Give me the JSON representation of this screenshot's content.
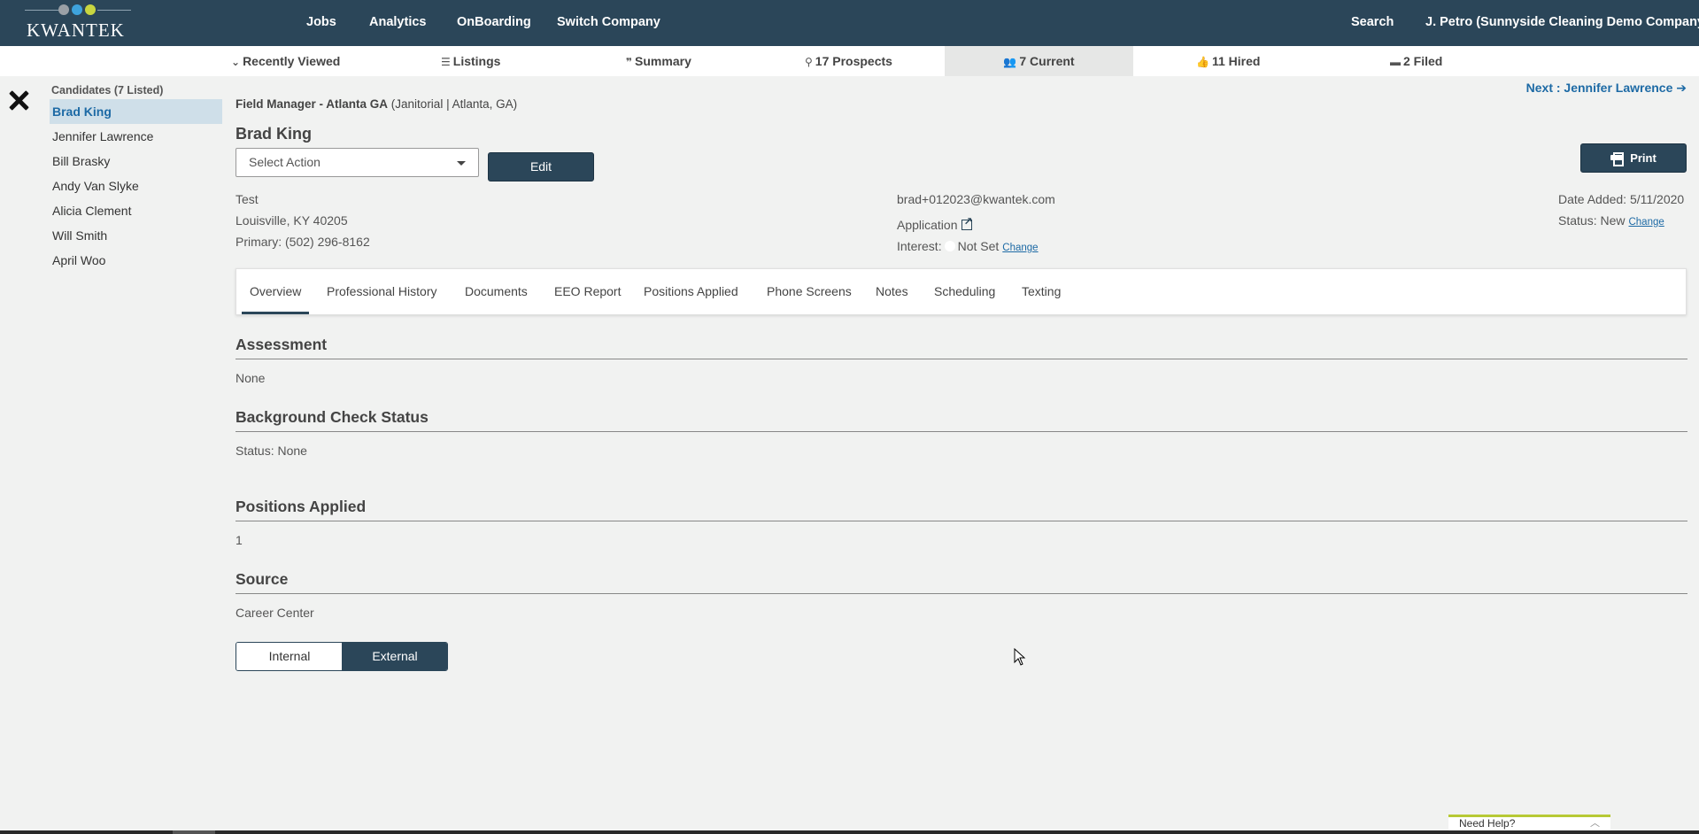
{
  "topnav": {
    "logo_text": "KWANTEK",
    "logo_dot_colors": [
      "#9aa0a6",
      "#3ea3dd",
      "#c8d640"
    ],
    "links": [
      "Jobs",
      "Analytics",
      "OnBoarding",
      "Switch Company"
    ],
    "search": "Search",
    "user": "J. Petro (Sunnyside Cleaning Demo Company)"
  },
  "subnav": {
    "recently_viewed": "Recently Viewed",
    "listings": "Listings",
    "summary": "Summary",
    "prospects": "17 Prospects",
    "current": "7 Current",
    "hired": "11 Hired",
    "filed": "2 Filed"
  },
  "candidates": {
    "header": "Candidates (7 Listed)",
    "items": [
      "Brad King",
      "Jennifer Lawrence",
      "Bill Brasky",
      "Andy Van Slyke",
      "Alicia Clement",
      "Will Smith",
      "April Woo"
    ],
    "selected_index": 0
  },
  "job": {
    "title": "Field Manager - Atlanta GA",
    "detail": "(Janitorial | Atlanta, GA)"
  },
  "next_link": "Next : Jennifer Lawrence",
  "candidate": {
    "name": "Brad King",
    "select_action": "Select Action",
    "edit_label": "Edit",
    "print_label": "Print",
    "address_line1": "Test",
    "address_line2": "Louisville, KY 40205",
    "phone": "Primary: (502) 296-8162",
    "email": "brad+012023@kwantek.com",
    "application": "Application",
    "interest_label": "Interest:",
    "interest_value": "Not Set",
    "interest_change": "Change",
    "date_added": "Date Added: 5/11/2020",
    "status": "Status: New",
    "status_change": "Change"
  },
  "tabs": [
    "Overview",
    "Professional History",
    "Documents",
    "EEO Report",
    "Positions Applied",
    "Phone Screens",
    "Notes",
    "Scheduling",
    "Texting"
  ],
  "sections": {
    "assessment_title": "Assessment",
    "assessment_value": "None",
    "background_title": "Background Check Status",
    "background_value": "Status: None",
    "positions_title": "Positions Applied",
    "positions_value": "1",
    "source_title": "Source",
    "source_value": "Career Center"
  },
  "toggle": {
    "internal": "Internal",
    "external": "External",
    "selected": "External"
  },
  "help": {
    "label": "Need Help?"
  },
  "colors": {
    "nav_bg": "#2b4659",
    "accent_link": "#1d6aa5",
    "selected_row": "#cfdfe9",
    "page_bg": "#f1f2f1"
  }
}
